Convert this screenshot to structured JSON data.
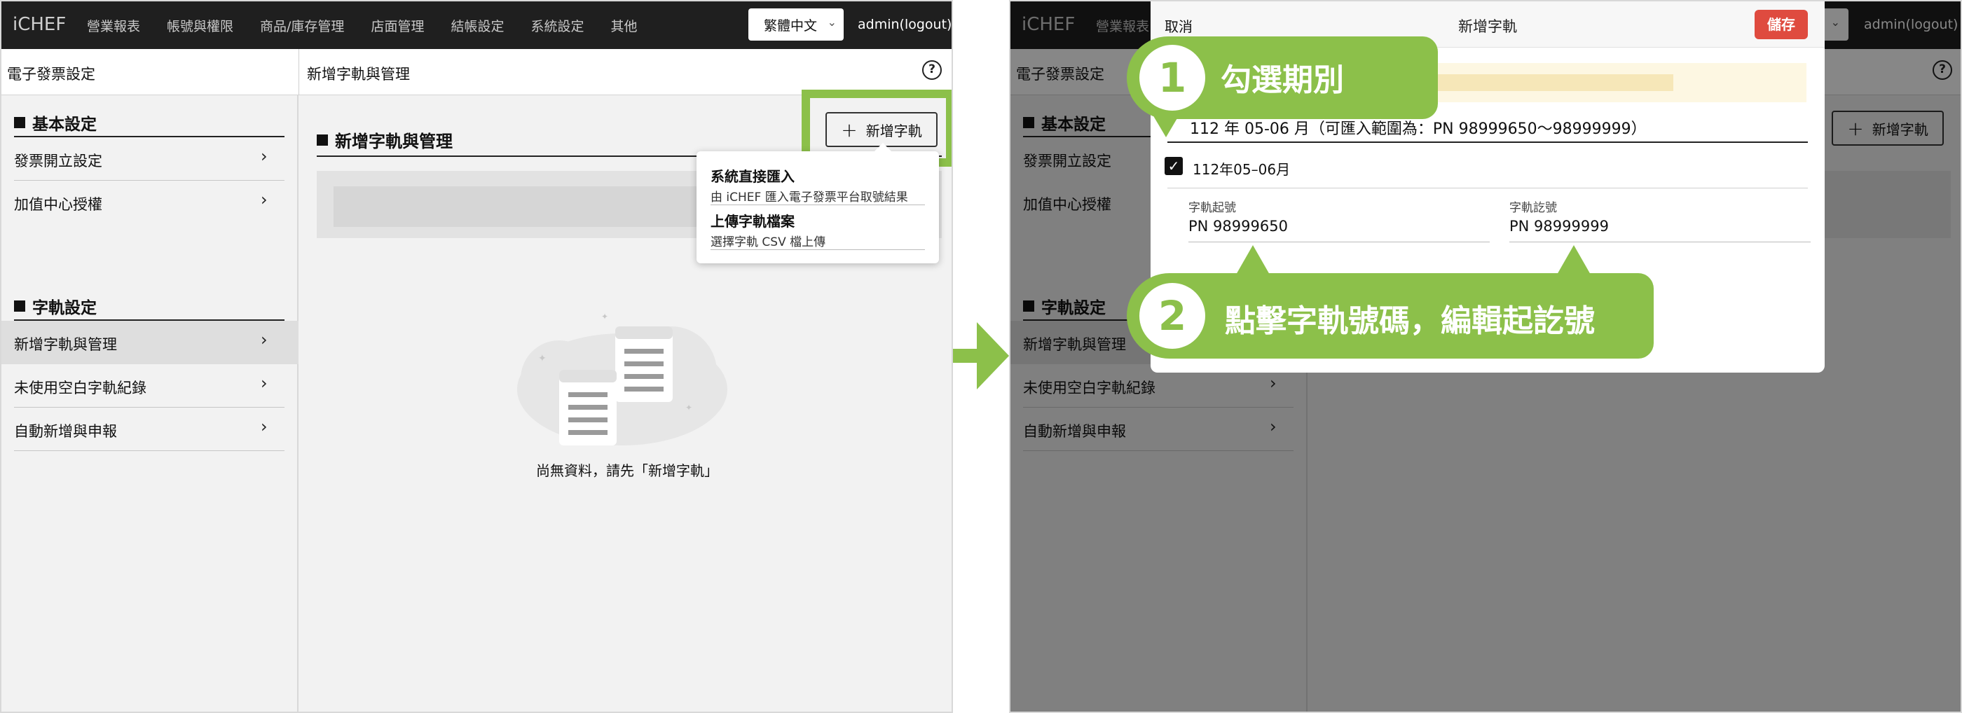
{
  "app": {
    "brand": "iCHEF",
    "nav": [
      "營業報表",
      "帳號與權限",
      "商品/庫存管理",
      "店面管理",
      "結帳設定",
      "系統設定",
      "其他"
    ],
    "language": "繁體中文",
    "user": "admin(logout)"
  },
  "left": {
    "subheader_left": "電子發票設定",
    "subheader_right": "新增字軌與管理",
    "help": "?",
    "sections": [
      {
        "title": "基本設定",
        "items": [
          {
            "label": "發票開立設定"
          },
          {
            "label": "加值中心授權"
          }
        ]
      },
      {
        "title": "字軌設定",
        "items": [
          {
            "label": "新增字軌與管理",
            "active": true
          },
          {
            "label": "未使用空白字軌紀錄"
          },
          {
            "label": "自動新增與申報"
          }
        ]
      }
    ],
    "content_title": "新增字軌與管理",
    "add_button": "新增字軌",
    "dropdown": [
      {
        "title": "系統直接匯入",
        "desc": "由 iCHEF 匯入電子發票平台取號結果"
      },
      {
        "title": "上傳字軌檔案",
        "desc": "選擇字軌 CSV 檔上傳"
      }
    ],
    "empty_text": "尚無資料，請先「新增字軌」"
  },
  "right": {
    "modal": {
      "cancel": "取消",
      "title": "新增字軌",
      "save": "儲存",
      "period_heading": "112 年 05-06 月（可匯入範圍為：PN 98999650～98999999）",
      "checkbox_label": "112年05–06月",
      "checkbox_checked": true,
      "start_label": "字軌起號",
      "start_value": "PN 98999650",
      "end_label": "字軌訖號",
      "end_value": "PN 98999999"
    },
    "callout_1": {
      "num": "1",
      "text": "勾選期別"
    },
    "callout_2": {
      "num": "2",
      "text": "點擊字軌號碼，編輯起訖號"
    }
  },
  "colors": {
    "accent_green": "#8cc04a",
    "save_red": "#df4b3f",
    "topbar": "#1f1f1f"
  }
}
